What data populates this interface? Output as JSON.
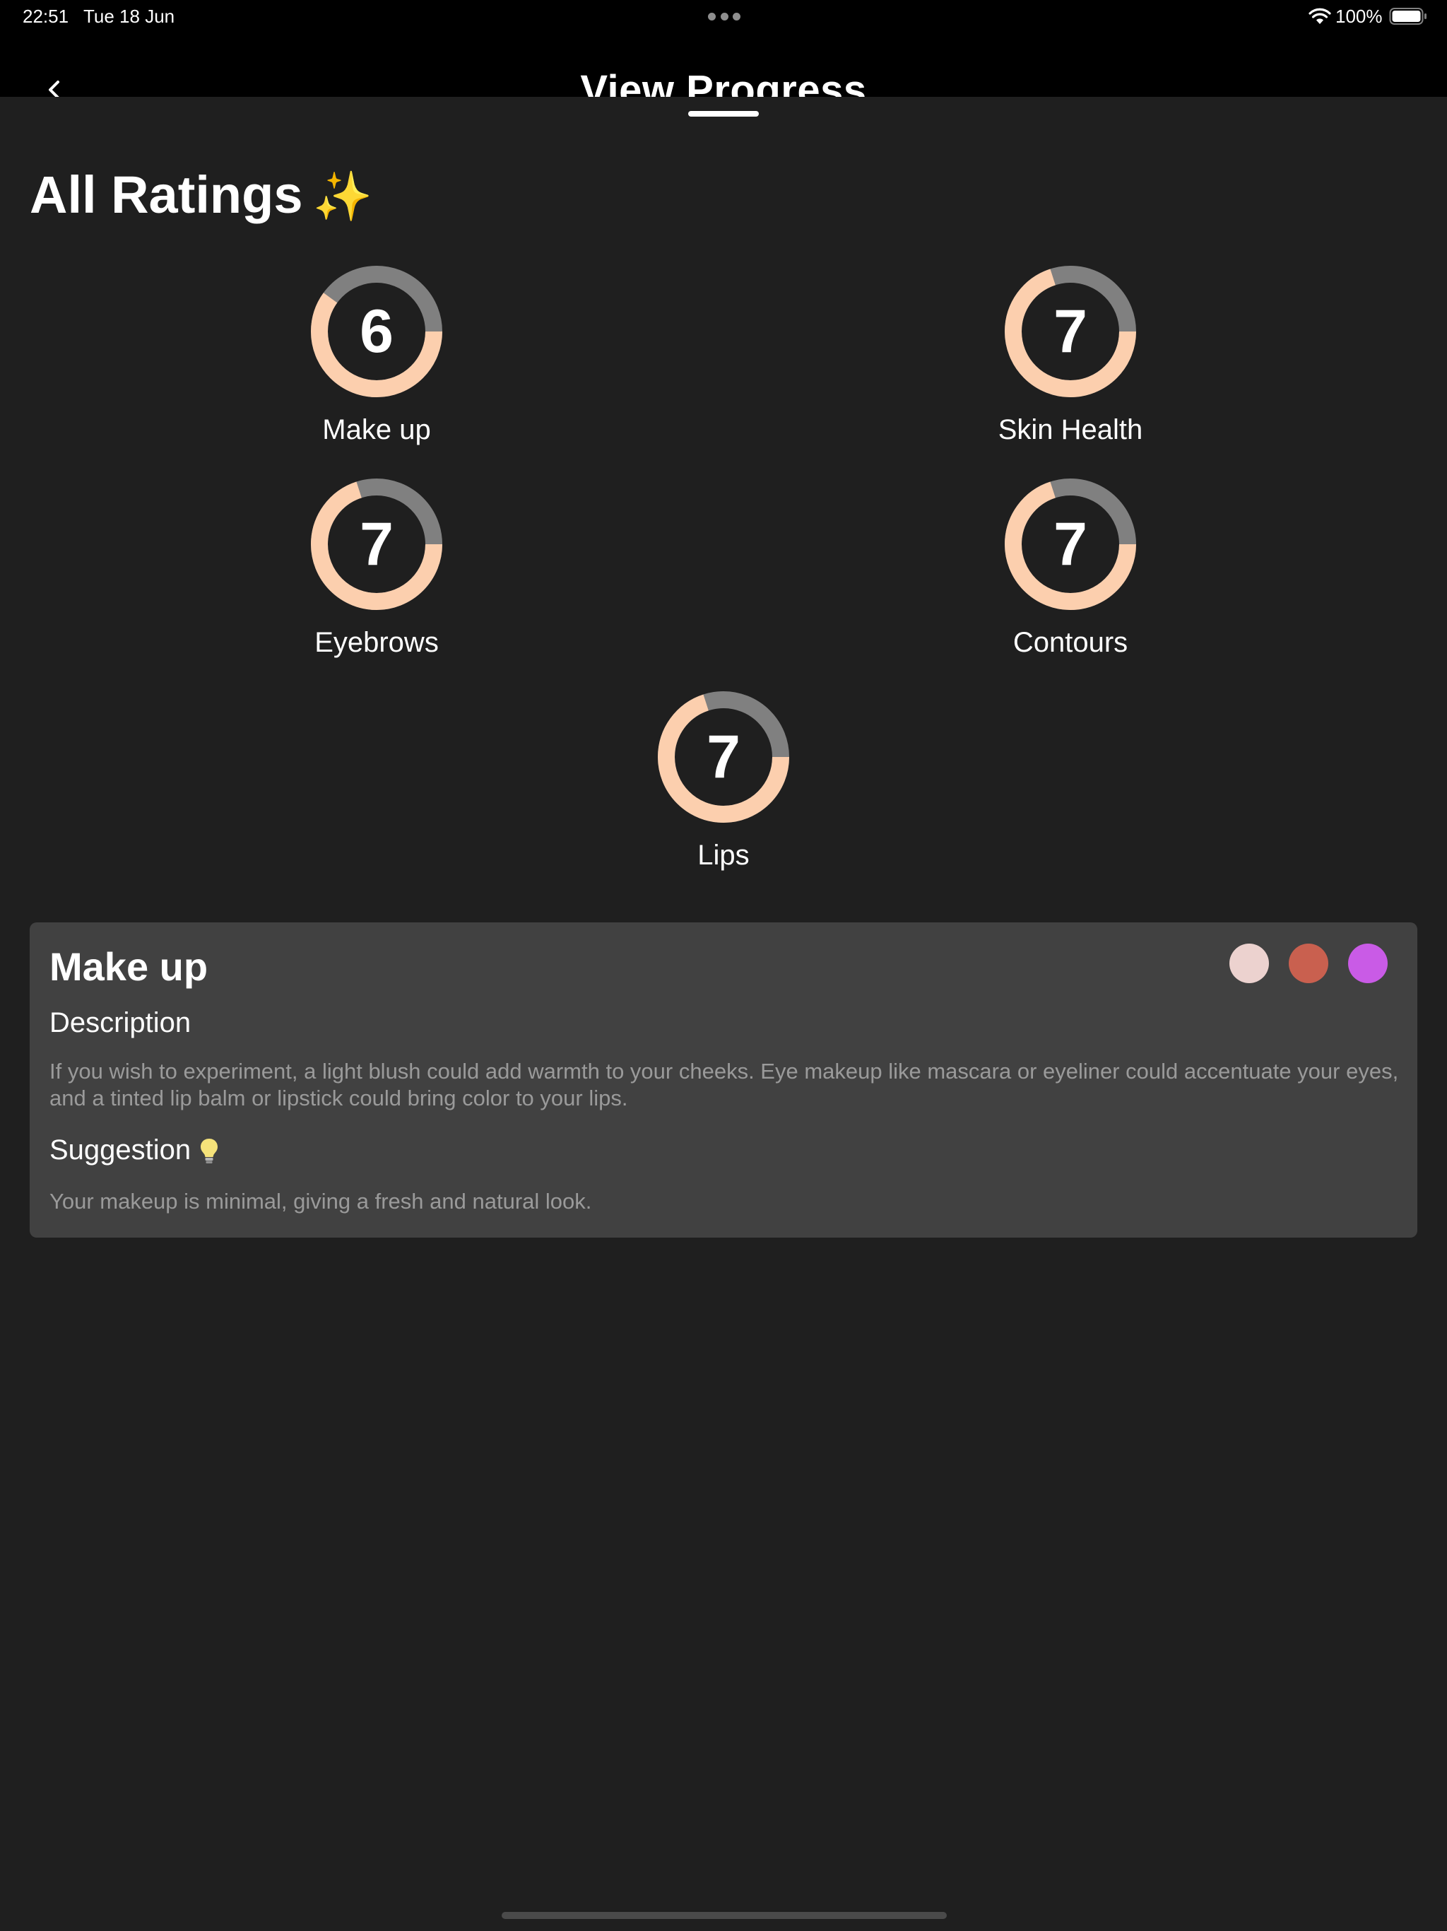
{
  "status_bar": {
    "time": "22:51",
    "date": "Tue 18 Jun",
    "battery": "100%",
    "wifi_icon": "wifi-icon",
    "battery_icon": "battery-icon"
  },
  "header": {
    "title": "View Progress",
    "back_icon": "chevron-left-icon"
  },
  "ratings": {
    "title": "All Ratings",
    "title_icon": "sparkles-icon",
    "max": 10,
    "items": [
      {
        "label": "Make up",
        "value": 6
      },
      {
        "label": "Skin Health",
        "value": 7
      },
      {
        "label": "Eyebrows",
        "value": 7
      },
      {
        "label": "Contours",
        "value": 7
      },
      {
        "label": "Lips",
        "value": 7
      }
    ]
  },
  "detail_card": {
    "title": "Make up",
    "swatch_colors": [
      "#ecd2cf",
      "#c9604f",
      "#c95be6"
    ],
    "description_heading": "Description",
    "description_text": "If you wish to experiment, a light blush could add warmth to your cheeks. Eye makeup like mascara or eyeliner could accentuate your eyes, and a tinted lip balm or lipstick could bring color to your lips.",
    "suggestion_heading": "Suggestion",
    "suggestion_icon": "lightbulb-icon",
    "suggestion_text": "Your makeup is minimal, giving a fresh and natural look."
  },
  "colors": {
    "ring_fill": "#fccfae",
    "ring_track": "#808080",
    "sheet_background": "#1f1f1f",
    "card_background": "#414141"
  }
}
